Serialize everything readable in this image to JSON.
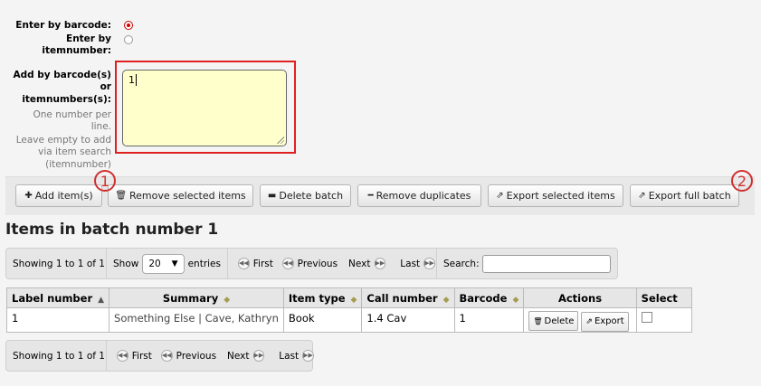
{
  "form": {
    "enter_by_barcode_label": "Enter by barcode:",
    "enter_by_itemnumber_label_1": "Enter by",
    "enter_by_itemnumber_label_2": "itemnumber:",
    "add_by_label_1": "Add by barcode(s)",
    "add_by_label_2": "or",
    "add_by_label_3": "itemnumbers(s):",
    "hint_1": "One number per",
    "hint_2": "line.",
    "hint_3": "Leave empty to add",
    "hint_4": "via item search",
    "hint_5": "(itemnumber)",
    "textarea_value": "1",
    "selected_mode": "barcode"
  },
  "toolbar": {
    "add_items": "Add item(s)",
    "remove_selected": "Remove selected items",
    "delete_batch": "Delete batch",
    "remove_duplicates": "Remove duplicates",
    "export_selected": "Export selected items",
    "export_full": "Export full batch"
  },
  "callouts": [
    "1",
    "2"
  ],
  "heading": "Items in batch number 1",
  "pager_top": {
    "showing": "Showing 1 to 1 of 1",
    "show": "Show",
    "page_size": "20",
    "entries": "entries",
    "first": "First",
    "previous": "Previous",
    "next": "Next",
    "last": "Last",
    "search_label": "Search:"
  },
  "table": {
    "headers": [
      "Label number",
      "Summary",
      "Item type",
      "Call number",
      "Barcode",
      "Actions",
      "Select"
    ],
    "rows": [
      {
        "label_number": "1",
        "summary_title": "Something Else",
        "summary_author": " | Cave, Kathryn",
        "item_type": "Book",
        "call_number": "1.4 Cav",
        "barcode": "1",
        "delete": "Delete",
        "export": "Export"
      }
    ]
  },
  "pager_bottom": {
    "showing": "Showing 1 to 1 of 1",
    "first": "First",
    "previous": "Previous",
    "next": "Next",
    "last": "Last"
  },
  "colors": {
    "highlight": "#e02020",
    "textarea_bg": "#ffffcc",
    "link": "#333333"
  }
}
